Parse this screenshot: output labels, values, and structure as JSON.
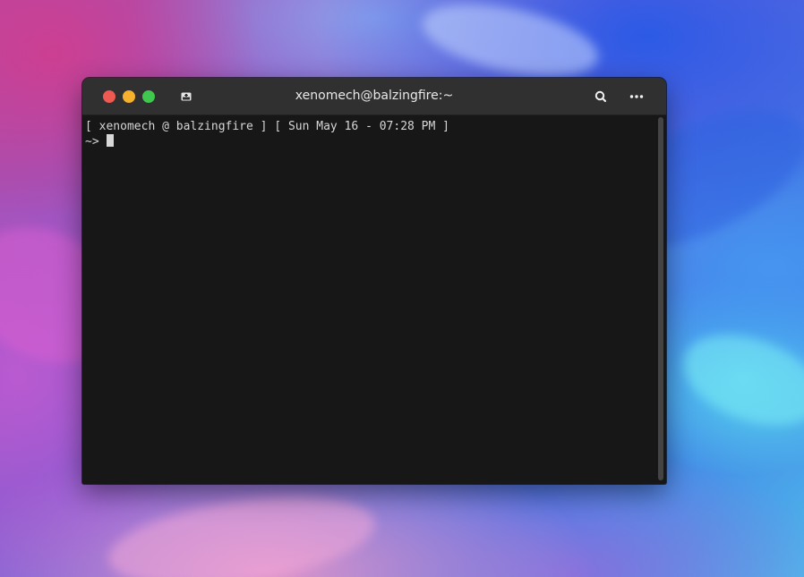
{
  "window": {
    "title": "xenomech@balzingfire:~"
  },
  "terminal": {
    "line1": "[ xenomech @ balzingfire ] [ Sun May 16 - 07:28 PM ]",
    "prompt": "~> "
  },
  "icons": {
    "new_tab": "new-tab-icon",
    "search": "search-icon",
    "menu": "more-menu-icon"
  },
  "colors": {
    "close": "#ee5a52",
    "minimize": "#f5b02e",
    "maximize": "#3fc750",
    "terminal_bg": "#171717",
    "titlebar_bg": "#303030"
  }
}
